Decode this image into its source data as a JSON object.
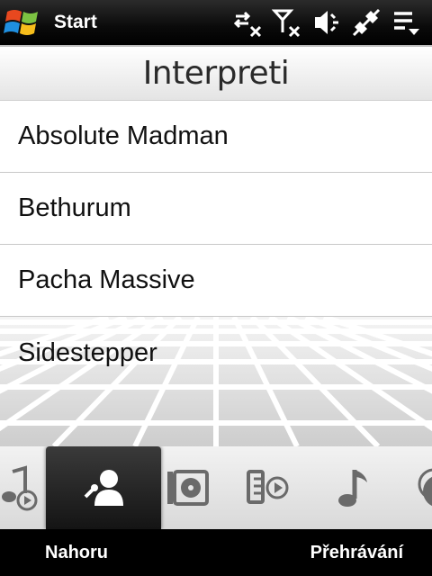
{
  "statusbar": {
    "start_label": "Start",
    "icons": [
      "data-sync-off-icon",
      "signal-off-icon",
      "speaker-muted-icon",
      "no-connection-icon",
      "menu-dropdown-icon"
    ]
  },
  "header": {
    "title": "Interpreti"
  },
  "artists": [
    {
      "name": "Absolute Madman"
    },
    {
      "name": "Bethurum"
    },
    {
      "name": "Pacha Massive"
    },
    {
      "name": "Sidestepper"
    }
  ],
  "tabs": [
    {
      "icon": "now-playing-icon",
      "active": false
    },
    {
      "icon": "artists-icon",
      "active": true
    },
    {
      "icon": "albums-icon",
      "active": false
    },
    {
      "icon": "playlists-icon",
      "active": false
    },
    {
      "icon": "songs-icon",
      "active": false
    },
    {
      "icon": "genres-icon",
      "active": false
    }
  ],
  "softkeys": {
    "left": "Nahoru",
    "right": "Přehrávání"
  },
  "colors": {
    "statusbar_bg": "#000000",
    "list_bg": "#ffffff",
    "active_tab_bg": "#1e1e1e",
    "icon_gray": "#6a6a6a"
  }
}
